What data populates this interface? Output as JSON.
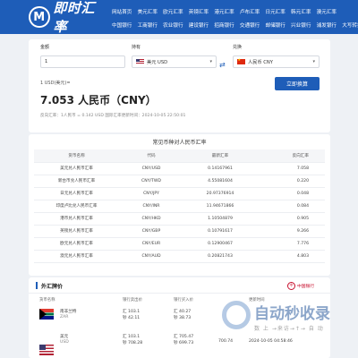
{
  "header": {
    "logo_mark": "M",
    "logo_text": "即时汇率",
    "nav_row1": [
      "网站首页",
      "美元汇率",
      "欧元汇率",
      "英镑汇率",
      "港元汇率",
      "卢布汇率",
      "日元汇率",
      "韩元汇率",
      "澳元汇率"
    ],
    "nav_row2": [
      "中国银行",
      "工商银行",
      "农业银行",
      "建设银行",
      "招商银行",
      "交通银行",
      "邮储银行",
      "兴业银行",
      "浦发银行",
      "大写转换"
    ]
  },
  "converter": {
    "amount_label": "金额",
    "amount_value": "1",
    "hold_label": "持有",
    "hold_value": "美元 USD",
    "exchange_label": "兑换",
    "exchange_value": "人民币 CNY",
    "swap_icon": "⇄",
    "convert_button": "立即换算",
    "result_small": "1 USD(美元)=",
    "result_big": "7.053 人民币（CNY）",
    "result_note": "反向汇率：1人民币 = 0.142 USD  国际汇率更新时间：2024-10-05 22:50:01"
  },
  "rates": {
    "title": "常见币种对人民币汇率",
    "headers": [
      "货币名称",
      "代码",
      "最新汇率",
      "反向汇率"
    ],
    "rows": [
      [
        "美元兑人民币汇率",
        "CNY/USD",
        "0.14167961",
        "7.058"
      ],
      [
        "新台币兑人民币汇率",
        "CNY/TWD",
        "4.55081604",
        "0.220"
      ],
      [
        "日元兑人民币汇率",
        "CNY/JPY",
        "20.97376914",
        "0.048"
      ],
      [
        "印度卢比兑人民币汇率",
        "CNY/INR",
        "11.94671866",
        "0.084"
      ],
      [
        "港币兑人民币汇率",
        "CNY/HKD",
        "1.10504879",
        "0.905"
      ],
      [
        "英镑兑人民币汇率",
        "CNY/GBP",
        "0.10791617",
        "9.266"
      ],
      [
        "欧元兑人民币汇率",
        "CNY/EUR",
        "0.12900467",
        "7.776"
      ],
      [
        "澳元兑人民币汇率",
        "CNY/AUD",
        "0.20821743",
        "4.803"
      ]
    ]
  },
  "bank": {
    "title": "外汇牌价",
    "logo_mark": "中",
    "logo_text": "中国银行",
    "headers": [
      "货币名称",
      "银行卖出价",
      "银行买入价",
      "",
      "",
      "更新时间"
    ],
    "rows": [
      {
        "name": "南非兰特",
        "code": "ZAR",
        "sell1": "汇 103.1",
        "sell2": "钞 42.11",
        "buy1": "汇 40.27",
        "buy2": "钞 38.73",
        "mid": "",
        "time": ""
      },
      {
        "name": "美元",
        "code": "USD",
        "sell1": "汇 103.1",
        "sell2": "钞 708.28",
        "buy1": "汇 705.47",
        "buy2": "钞 699.73",
        "mid": "700.74",
        "time": "2024-10-05 04:58:46"
      }
    ]
  },
  "watermark": {
    "main": "自动秒收录",
    "sub": "数 上 →来访→↑→ 自 动"
  }
}
